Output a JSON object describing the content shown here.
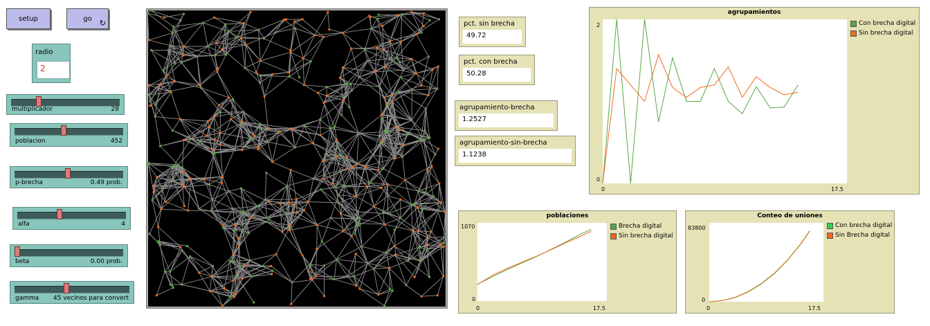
{
  "buttons": {
    "setup": "setup",
    "go": "go",
    "go_forever_icon": "↻"
  },
  "input": {
    "label": "radio",
    "value": "2"
  },
  "sliders": [
    {
      "name": "multiplicador",
      "value": "28",
      "fraction": 0.24
    },
    {
      "name": "poblacion",
      "value": "452",
      "fraction": 0.45
    },
    {
      "name": "p-brecha",
      "value": "0.49 prob.",
      "fraction": 0.49
    },
    {
      "name": "alfa",
      "value": "4",
      "fraction": 0.38
    },
    {
      "name": "beta",
      "value": "0.00 prob.",
      "fraction": 0.0
    },
    {
      "name": "gamma",
      "value": "45 vecinos para convert",
      "fraction": 0.45
    }
  ],
  "monitors": [
    {
      "label": "pct. sin brecha",
      "value": "49.72"
    },
    {
      "label": "pct. con brecha",
      "value": "50.28"
    },
    {
      "label": "agrupamiento-brecha",
      "value": "1.2527"
    },
    {
      "label": "agrupamiento-sin-brecha",
      "value": "1.1238"
    }
  ],
  "colors": {
    "green": "#55a644",
    "orange": "#f06a1c",
    "links": "#8f8f8f",
    "background": "#000000"
  },
  "chart_data": [
    {
      "type": "line",
      "title": "agrupamientos",
      "xlim": [
        0,
        17.5
      ],
      "ylim": [
        0,
        2
      ],
      "x_tick_labels": [
        "0",
        "17.5"
      ],
      "y_tick_labels": [
        "0",
        "2"
      ],
      "legend_position": "right",
      "series": [
        {
          "name": "Con brecha digital",
          "color": "#55a644",
          "x": [
            0,
            1,
            2,
            3,
            4,
            5,
            6,
            7,
            8,
            9,
            10,
            11,
            12,
            13,
            14,
            15
          ],
          "y": [
            0,
            2.0,
            0,
            2.0,
            0.75,
            1.53,
            1.0,
            1.0,
            1.4,
            1.0,
            0.85,
            1.18,
            0.92,
            0.93,
            1.2,
            null
          ]
        },
        {
          "name": "Sin brecha digital",
          "color": "#f06a1c",
          "x": [
            0,
            1,
            2,
            3,
            4,
            5,
            6,
            7,
            8,
            9,
            10,
            11,
            12,
            13,
            14,
            15
          ],
          "y": [
            0,
            1.4,
            1.2,
            1.0,
            1.57,
            1.17,
            1.05,
            1.17,
            1.2,
            1.42,
            1.05,
            1.3,
            1.17,
            1.08,
            1.11,
            null
          ]
        }
      ]
    },
    {
      "type": "line",
      "title": "poblaciones",
      "xlim": [
        0,
        17.5
      ],
      "ylim": [
        0,
        1070
      ],
      "x_tick_labels": [
        "0",
        "17.5"
      ],
      "y_tick_labels": [
        "0",
        "1070"
      ],
      "legend_position": "right",
      "series": [
        {
          "name": "Brecha digital",
          "color": "#55a644",
          "x": [
            0,
            2,
            4,
            6,
            8,
            10,
            12,
            14,
            15.4
          ],
          "y": [
            230,
            330,
            430,
            520,
            610,
            710,
            810,
            920,
            980
          ]
        },
        {
          "name": "Sin brecha digital",
          "color": "#f06a1c",
          "x": [
            0,
            2,
            4,
            6,
            8,
            10,
            12,
            14,
            15.4
          ],
          "y": [
            225,
            350,
            445,
            530,
            615,
            705,
            800,
            890,
            955
          ]
        }
      ]
    },
    {
      "type": "line",
      "title": "Conteo de uniones",
      "xlim": [
        0,
        17.5
      ],
      "ylim": [
        0,
        83800
      ],
      "x_tick_labels": [
        "0",
        "17.5"
      ],
      "y_tick_labels": [
        "0",
        "83800"
      ],
      "legend_position": "right",
      "series": [
        {
          "name": "Con brecha digital",
          "color": "#33cc55",
          "x": [
            0,
            2,
            4,
            6,
            8,
            10,
            12,
            14,
            15.4
          ],
          "y": [
            0,
            1200,
            4500,
            10500,
            19000,
            30000,
            44000,
            61000,
            75000
          ]
        },
        {
          "name": "Sin Brecha digital",
          "color": "#f06a1c",
          "x": [
            0,
            2,
            4,
            6,
            8,
            10,
            12,
            14,
            15.4
          ],
          "y": [
            0,
            1300,
            4800,
            11000,
            19500,
            30500,
            44500,
            61500,
            75500
          ]
        }
      ]
    }
  ]
}
